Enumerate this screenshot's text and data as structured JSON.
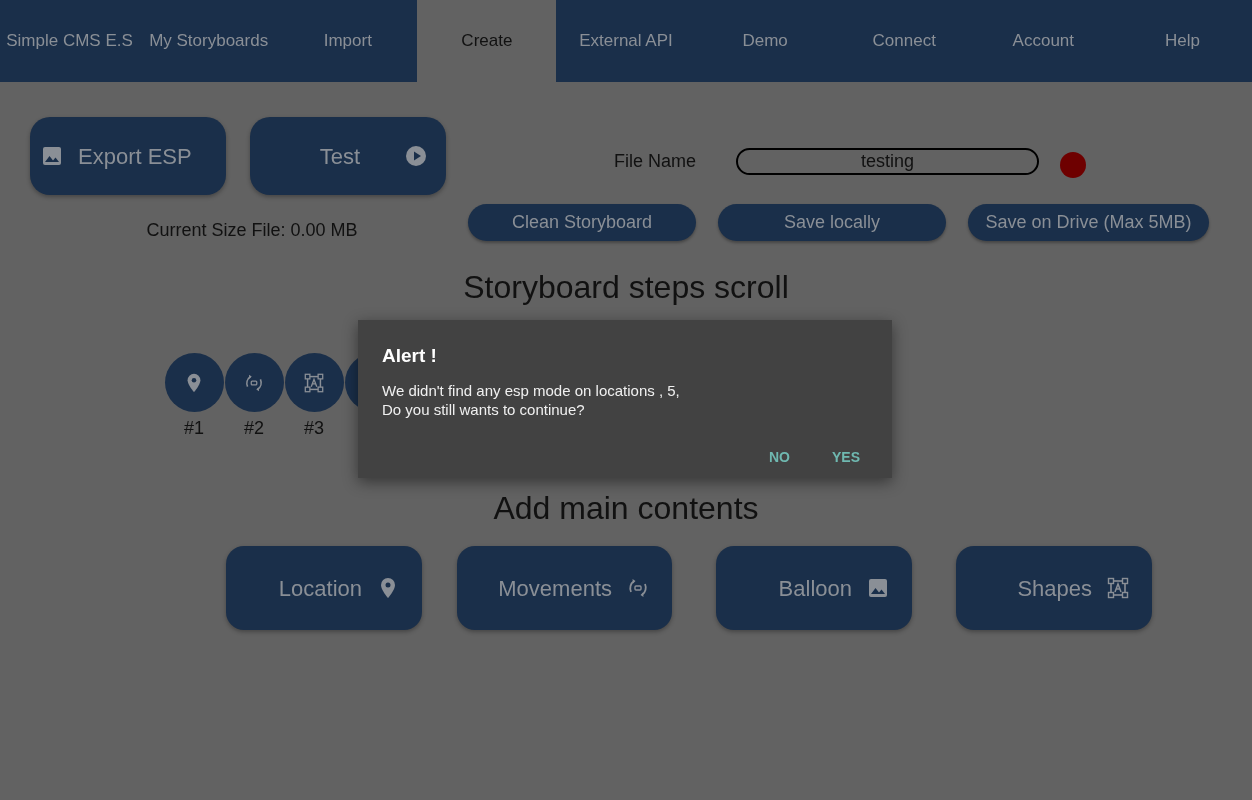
{
  "tabs": [
    {
      "label": "Simple CMS E.S",
      "selected": false
    },
    {
      "label": "My Storyboards",
      "selected": false
    },
    {
      "label": "Import",
      "selected": false
    },
    {
      "label": "Create",
      "selected": true
    },
    {
      "label": "External API",
      "selected": false
    },
    {
      "label": "Demo",
      "selected": false
    },
    {
      "label": "Connect",
      "selected": false
    },
    {
      "label": "Account",
      "selected": false
    },
    {
      "label": "Help",
      "selected": false
    }
  ],
  "actions": [
    {
      "label": "Export ESP",
      "kind": "image"
    },
    {
      "label": "Test",
      "kind": "play"
    }
  ],
  "size_text": "Current Size File:  0.00 MB",
  "file": {
    "label": "File Name",
    "value": "testing",
    "indicator_on": true
  },
  "file_buttons": [
    "Clean Storyboard",
    "Save locally",
    "Save on Drive (Max 5MB)"
  ],
  "steps_title": "Storyboard steps scroll",
  "steps": [
    {
      "kind": "pin",
      "label": "#1"
    },
    {
      "kind": "rotate3d",
      "label": "#2"
    },
    {
      "kind": "shape",
      "label": "#3"
    },
    {
      "kind": "covered"
    }
  ],
  "contents_title": "Add main contents",
  "contents": [
    {
      "label": "Location",
      "kind": "pin"
    },
    {
      "label": "Movements",
      "kind": "rotate3d"
    },
    {
      "label": "Balloon",
      "kind": "image"
    },
    {
      "label": "Shapes",
      "kind": "shape"
    }
  ],
  "dialog": {
    "title": "Alert !",
    "message": [
      "We didn't find any esp mode on locations , 5,",
      "Do you still wants to continue?"
    ],
    "buttons": [
      "NO",
      "YES"
    ]
  }
}
